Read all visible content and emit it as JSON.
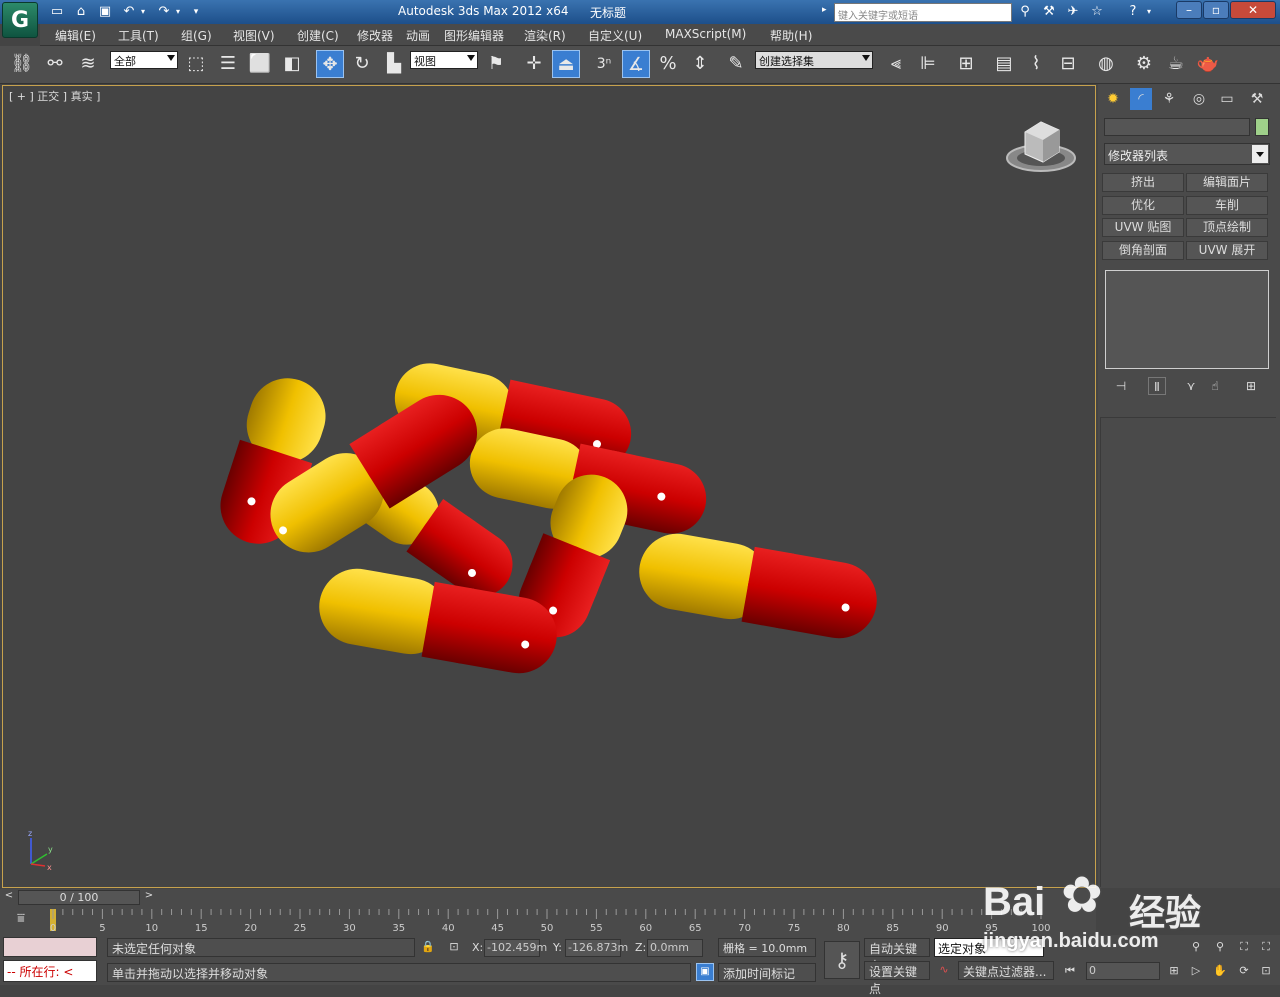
{
  "title": {
    "app": "Autodesk 3ds Max  2012 x64",
    "doc": "无标题",
    "search_placeholder": "键入关键字或短语"
  },
  "menu": [
    "编辑(E)",
    "工具(T)",
    "组(G)",
    "视图(V)",
    "创建(C)",
    "修改器",
    "动画",
    "图形编辑器",
    "渲染(R)",
    "自定义(U)",
    "MAXScript(M)",
    "帮助(H)"
  ],
  "toolbar": {
    "filter": "全部",
    "ref_coord": "视图",
    "selection_set": "创建选择集",
    "snap_number": "3"
  },
  "viewport": {
    "label": "[ + ] 正交 ] 真实 ]",
    "axis_labels": {
      "z": "z",
      "y": "y",
      "x": "x"
    }
  },
  "cmdpanel": {
    "modifier_list": "修改器列表",
    "buttons": [
      "挤出",
      "编辑面片",
      "优化",
      "车削",
      "UVW 贴图",
      "顶点绘制",
      "倒角剖面",
      "UVW 展开"
    ]
  },
  "timeslider": {
    "frame": "0 / 100",
    "ticks": [
      "0",
      "5",
      "10",
      "15",
      "20",
      "25",
      "30",
      "35",
      "40",
      "45",
      "50",
      "55",
      "60",
      "65",
      "70",
      "75",
      "80",
      "85",
      "90",
      "95",
      "100"
    ]
  },
  "status": {
    "running": "所在行:",
    "selection": "未选定任何对象",
    "prompt": "单击并拖动以选择并移动对象",
    "x_label": "X:",
    "x_value": "-102.459m",
    "y_label": "Y:",
    "y_value": "-126.873m",
    "z_label": "Z:",
    "z_value": "0.0mm",
    "grid": "栅格 = 10.0mm",
    "add_time_tag": "添加时间标记",
    "auto_key": "自动关键点",
    "set_key": "设置关键点",
    "selected_obj": "选定对象",
    "key_filter": "关键点过滤器...",
    "frame_field": "0"
  },
  "watermark": {
    "brand": "Bai",
    "suffix": "经验",
    "url": "jingyan.baidu.com"
  },
  "colors": {
    "capsule_red": "#cc0000",
    "capsule_yellow": "#f0c000",
    "active_button": "#3a7ed1",
    "viewport_border": "#c7a24d"
  }
}
